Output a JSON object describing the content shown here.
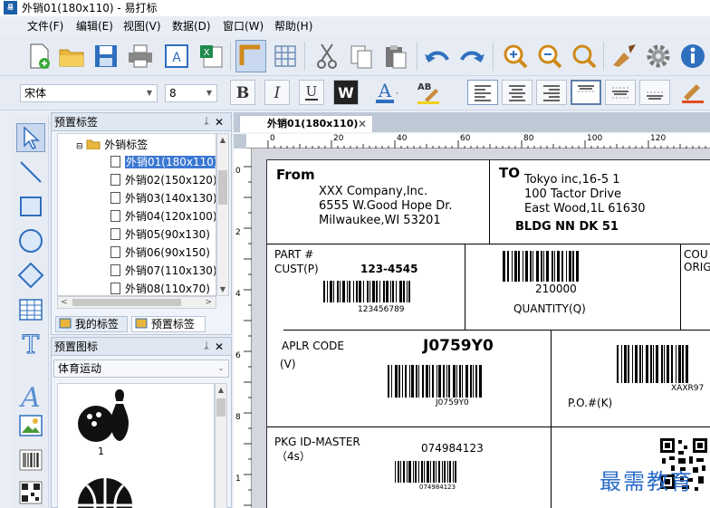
{
  "window": {
    "title": "外销01(180x110) - 易打标",
    "app_icon_text": "易打标"
  },
  "menu": [
    "文件(F)",
    "编辑(E)",
    "视图(V)",
    "数据(D)",
    "窗口(W)",
    "帮助(H)"
  ],
  "toolbar": {
    "font": "宋体",
    "font_size": "8"
  },
  "panel_labels": {
    "title": "预置标签",
    "root": "外销标签",
    "items": [
      "外销01(180x110)",
      "外销02(150x120)",
      "外销03(140x130)",
      "外销04(120x100)",
      "外销05(90x130)",
      "外销06(90x150)",
      "外销07(110x130)",
      "外销08(110x70)"
    ],
    "tab_mine": "我的标签",
    "tab_preset": "预置标签"
  },
  "panel_icons": {
    "title": "预置图标",
    "category": "体育运动",
    "item1_number": "1"
  },
  "document": {
    "tab": "外销01(180x110)",
    "ruler_h": [
      "0",
      "20",
      "40",
      "60",
      "80",
      "100",
      "120"
    ],
    "ruler_v": [
      "0",
      "2",
      "4",
      "6",
      "8",
      "1"
    ]
  },
  "label": {
    "from_title": "From",
    "from_lines": [
      "XXX Company,Inc.",
      "6555 W.Good Hope Dr.",
      "Milwaukee,WI 53201"
    ],
    "to_title": "TO",
    "to_lines": [
      "Tokyo inc,16-5 1",
      "100 Tactor Drive",
      "East Wood,1L 61630"
    ],
    "to_bold": "BLDG NN DK 51",
    "part_label": "PART #",
    "cust_label": "CUST(P)",
    "cust_value": "123-4545",
    "barcode1_text": "123456789",
    "qty_number": "210000",
    "qty_label": "QUANTITY(Q)",
    "cou_label": "COU",
    "orig_label": "ORIG",
    "aplr_label": "APLR CODE",
    "v_label": "(V)",
    "aplr_value": "J0759Y0",
    "barcode_aplr_text": "J0759Y0",
    "xaxr_text": "XAXR97",
    "po_label": "P.O.#(K)",
    "pkg_label": "PKG ID-MASTER",
    "pkg_sub": "（4s）",
    "pkg_value": "074984123",
    "barcode_pkg_text": "074984123"
  },
  "watermark": "最需教育"
}
